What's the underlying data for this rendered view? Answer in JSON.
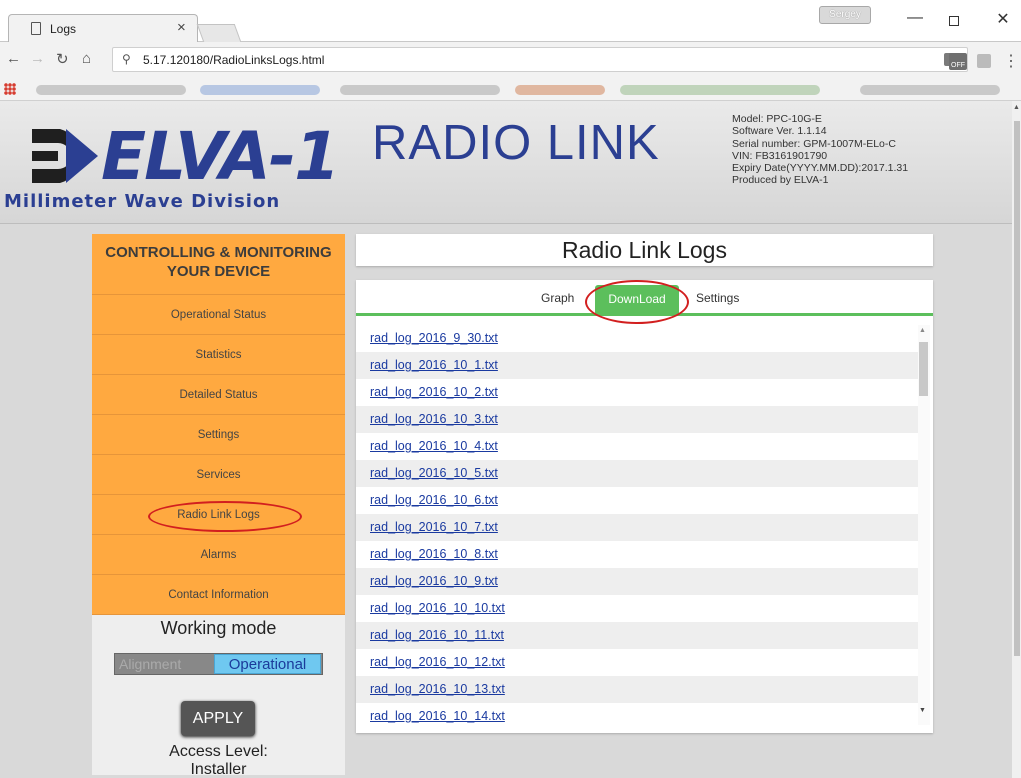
{
  "browser": {
    "tab_title": "Logs",
    "tab_close": "×",
    "profile_name": "Sergey",
    "url": "5.17.120180/RadioLinksLogs.html",
    "minimize": "—",
    "close": "✕",
    "ext_label": "OFF"
  },
  "header": {
    "logo_text": "ELVA-1",
    "logo_subtitle": "Millimeter Wave Division",
    "title": "RADIO LINK",
    "device_info": [
      "Model: PPC-10G-E",
      "Software Ver. 1.1.14",
      "Serial number: GPM-1007M-ELo-C",
      "VIN: FB3161901790",
      "Expiry Date(YYYY.MM.DD):2017.1.31",
      "Produced by ELVA-1"
    ],
    "brand_color": "#2b3f92"
  },
  "sidebar": {
    "header": "CONTROLLING & MONITORING YOUR DEVICE",
    "items": [
      {
        "label": "Operational Status"
      },
      {
        "label": "Statistics"
      },
      {
        "label": "Detailed Status"
      },
      {
        "label": "Settings"
      },
      {
        "label": "Services"
      },
      {
        "label": "Radio Link Logs"
      },
      {
        "label": "Alarms"
      },
      {
        "label": "Contact Information"
      }
    ],
    "working_mode_title": "Working mode",
    "mode_alignment": "Alignment",
    "mode_operational": "Operational",
    "apply_label": "APPLY",
    "access_level_label": "Access Level:",
    "access_level_value": "Installer",
    "accent_color": "#ffa940"
  },
  "main": {
    "title": "Radio Link Logs",
    "tabs": {
      "graph": "Graph",
      "download": "DownLoad",
      "settings": "Settings"
    },
    "logs": [
      "rad_log_2016_9_30.txt",
      "rad_log_2016_10_1.txt",
      "rad_log_2016_10_2.txt",
      "rad_log_2016_10_3.txt",
      "rad_log_2016_10_4.txt",
      "rad_log_2016_10_5.txt",
      "rad_log_2016_10_6.txt",
      "rad_log_2016_10_7.txt",
      "rad_log_2016_10_8.txt",
      "rad_log_2016_10_9.txt",
      "rad_log_2016_10_10.txt",
      "rad_log_2016_10_11.txt",
      "rad_log_2016_10_12.txt",
      "rad_log_2016_10_13.txt",
      "rad_log_2016_10_14.txt"
    ],
    "active_tab_color": "#5cbf5c",
    "highlight_color": "#d21f1f"
  }
}
